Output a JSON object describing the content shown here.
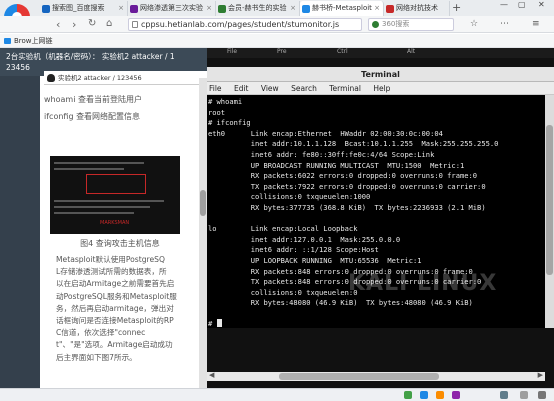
{
  "browser": {
    "tabs": [
      {
        "label": "搜索图_百度搜索",
        "color": "#1565c0"
      },
      {
        "label": "网络渗透第三次实验",
        "color": "#6a1b9a"
      },
      {
        "label": "会员-赫书生的实验",
        "color": "#2e7d32"
      },
      {
        "label": "赫书桥-Metasploit",
        "color": "#1e88e5"
      },
      {
        "label": "网络对抗技术",
        "color": "#c62828"
      }
    ],
    "close_glyph": "×",
    "new_tab_glyph": "+",
    "url": "cppsu.hetianlab.com/pages/student/stumonitor.js",
    "search_placeholder": "360搜索",
    "bookmark": "Brow上网链",
    "nav": {
      "back": "‹",
      "forward": "›",
      "reload": "↻",
      "home": "⌂"
    },
    "window_controls": {
      "min": "—",
      "max": "▢",
      "close": "✕"
    },
    "toolbar_icons": {
      "menu": "≡",
      "star": "☆",
      "more": "⋯"
    }
  },
  "lab": {
    "header_line1": "2台实验机（机器名/密码）：  实验机2    attacker / 1",
    "header_line2": "23456",
    "vm_tab": "实验机2    attacker / 123456"
  },
  "article": {
    "lines": [
      "whoami 查看当前登陆用户",
      "ifconfig 查看网络配置信息"
    ],
    "figure_caption": "图4 查询攻击主机信息",
    "body_lines": [
      "Metasploit默认使用PostgreSQ",
      "L存储渗透测试所需的数据表，所",
      "以在启动Armitage之前需要首先启",
      "动PostgreSQL服务和Metasploit服",
      "务，然后再启动armitage，弹出对",
      "话框询问是否连接Metasploit的RP",
      "C信道，依次选择\"connec",
      "t\"、\"是\"选项。Armitage启动成功",
      "后主界面如下图7所示。"
    ],
    "figure_brand": "MARKSMAN"
  },
  "terminal": {
    "title": "Terminal",
    "menu": [
      "File",
      "Edit",
      "View",
      "Search",
      "Terminal",
      "Help"
    ],
    "output": "# whoami\nroot\n# ifconfig\neth0      Link encap:Ethernet  HWaddr 02:00:30:0c:00:04\n          inet addr:10.1.1.128  Bcast:10.1.1.255  Mask:255.255.255.0\n          inet6 addr: fe80::30ff:fe0c:4/64 Scope:Link\n          UP BROADCAST RUNNING MULTICAST  MTU:1500  Metric:1\n          RX packets:6022 errors:0 dropped:0 overruns:0 frame:0\n          TX packets:7922 errors:0 dropped:0 overruns:0 carrier:0\n          collisions:0 txqueuelen:1000\n          RX bytes:377735 (368.8 KiB)  TX bytes:2236933 (2.1 MiB)\n\nlo        Link encap:Local Loopback\n          inet addr:127.0.0.1  Mask:255.0.0.0\n          inet6 addr: ::1/128 Scope:Host\n          UP LOOPBACK RUNNING  MTU:65536  Metric:1\n          RX packets:848 errors:0 dropped:0 overruns:0 frame:0\n          TX packets:848 errors:0 dropped:0 overruns:0 carrier:0\n          collisions:0 txqueuelen:0\n          RX bytes:48080 (46.9 KiB)  TX bytes:48080 (46.9 KiB)\n\n# ",
    "watermark": "KALI LINUX"
  },
  "vm_topbar": [
    "File",
    "Pre",
    "Ctrl",
    "Alt"
  ],
  "colors": {
    "lab_header": "#3c4a57",
    "terminal_bg": "#000000",
    "terminal_fg": "#e8e8e8"
  }
}
